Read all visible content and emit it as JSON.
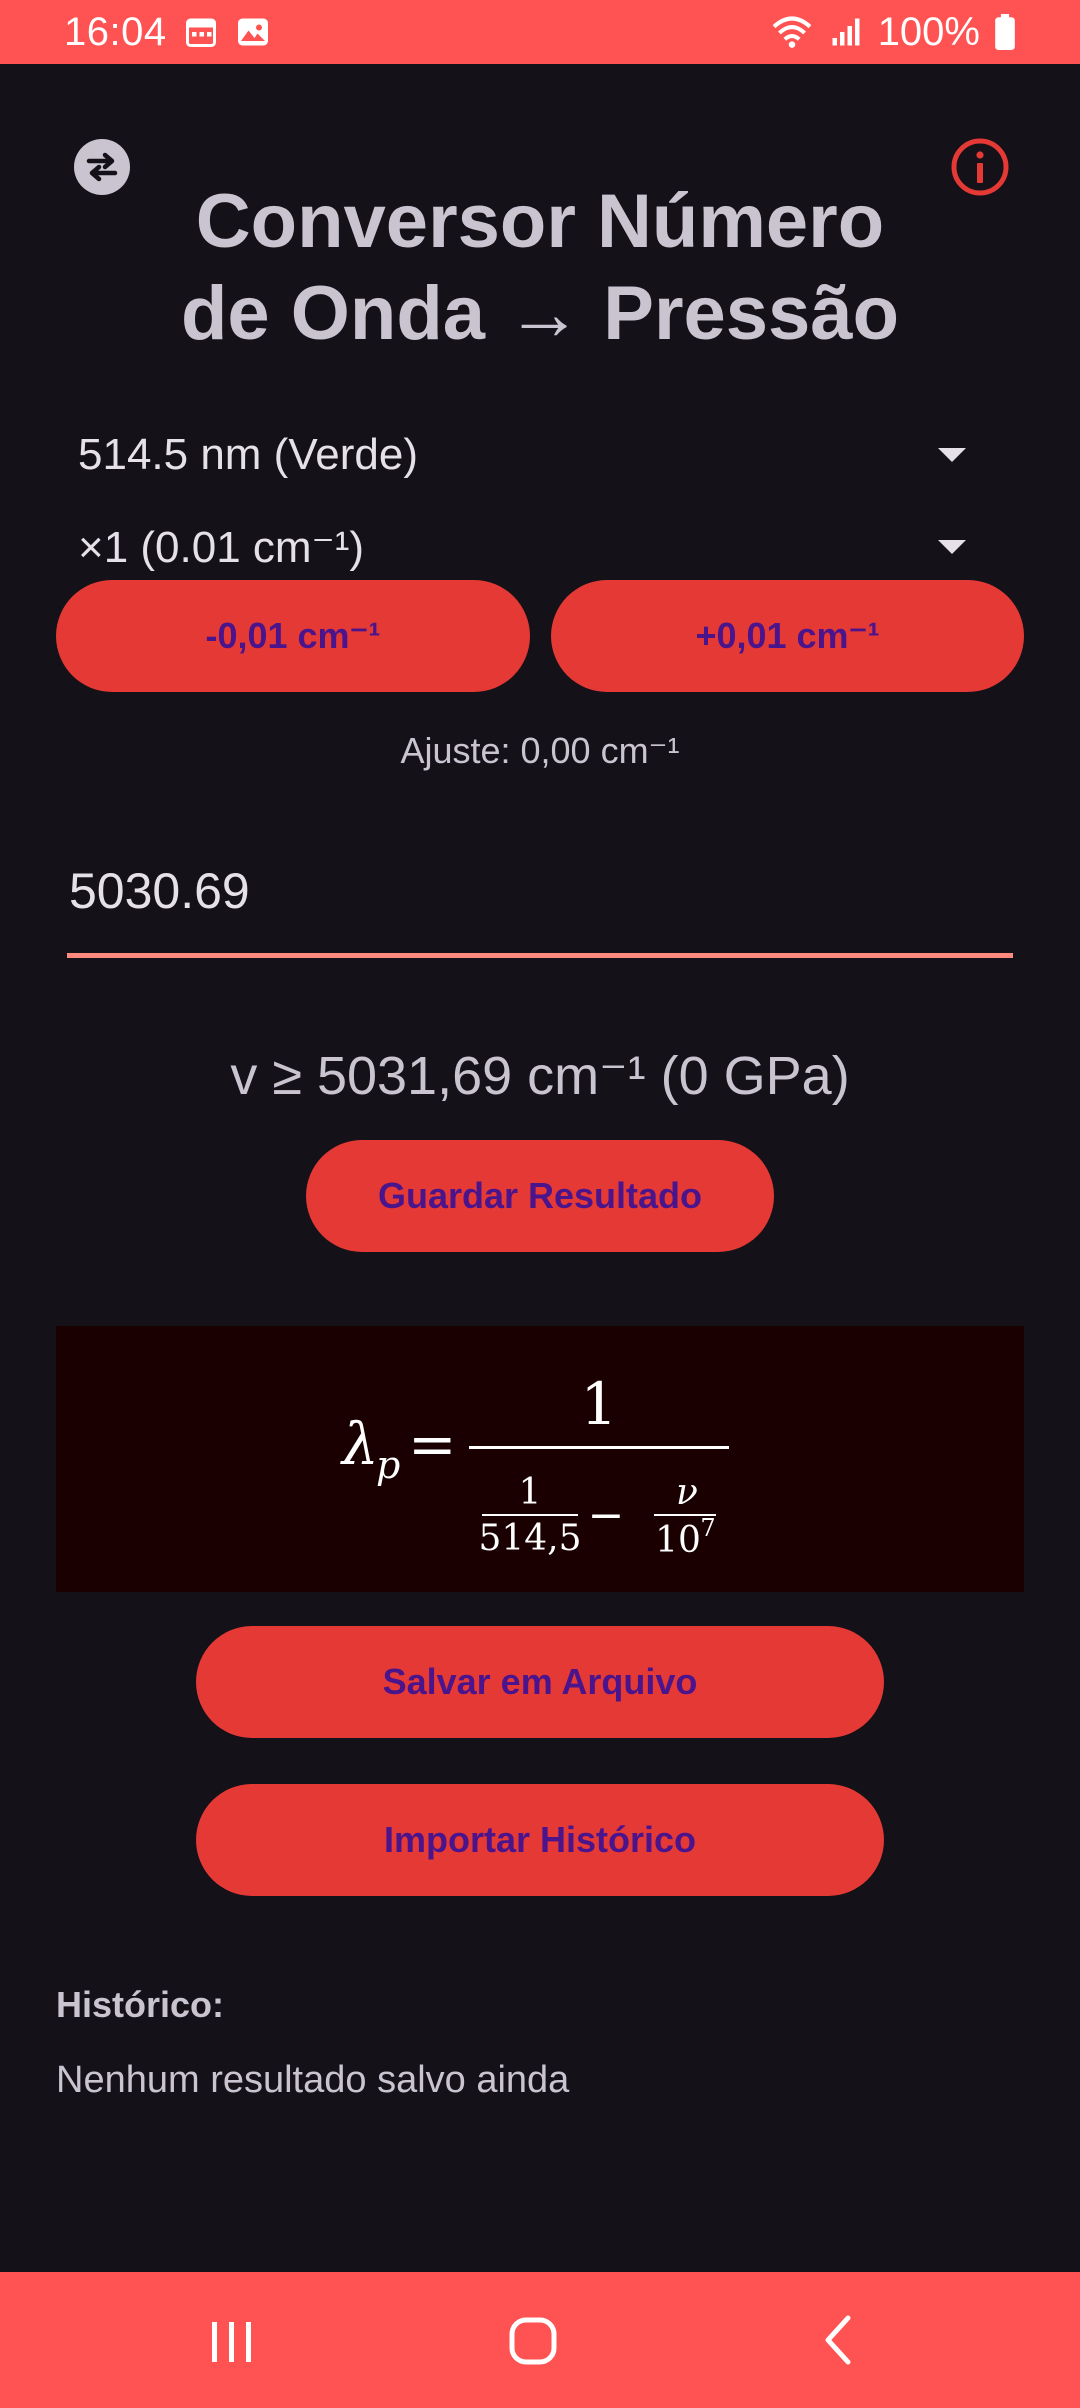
{
  "status": {
    "time": "16:04",
    "battery": "100%",
    "icons": [
      "calendar-icon",
      "image-icon",
      "wifi-icon",
      "signal-icon",
      "battery-icon"
    ]
  },
  "header": {
    "title_line1": "Conversor Número",
    "title_line2": "de Onda → Pressão",
    "swap_icon": "swap-icon",
    "info_icon": "info-icon"
  },
  "laser_select": {
    "value": "514.5 nm (Verde)"
  },
  "step_select": {
    "value": "×1 (0.01 cm⁻¹)"
  },
  "adjust_buttons": {
    "minus_label": "-0,01 cm⁻¹",
    "plus_label": "+0,01 cm⁻¹"
  },
  "adjust_text": "Ajuste: 0,00 cm⁻¹",
  "input": {
    "value": "5030.69"
  },
  "result_text": "v ≥ 5031,69 cm⁻¹ (0 GPa)",
  "buttons": {
    "save_result": "Guardar Resultado",
    "save_file": "Salvar em Arquivo",
    "import_history": "Importar Histórico"
  },
  "formula": {
    "lhs": "λ",
    "subscript": "p",
    "equals": "=",
    "numerator": "1",
    "inner_num1": "1",
    "inner_den1": "514,5",
    "minus": "−",
    "inner_num2": "ν",
    "inner_den2": "10",
    "inner_den2_exp": "7"
  },
  "history": {
    "title": "Histórico:",
    "empty_text": "Nenhum resultado salvo ainda"
  },
  "colors": {
    "accent": "#e53935",
    "bars": "#ff5252",
    "button_text": "#4a148c",
    "background": "#141218"
  }
}
